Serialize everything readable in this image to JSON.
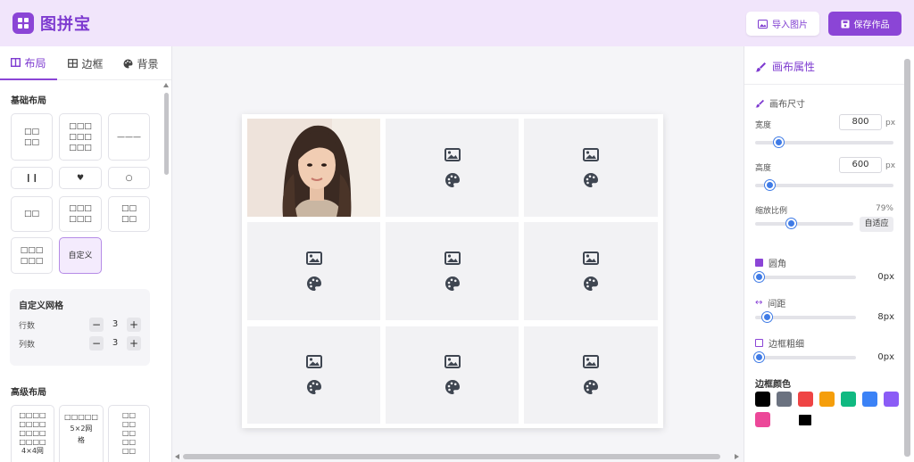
{
  "header": {
    "app_title": "图拼宝",
    "import_label": "导入图片",
    "save_label": "保存作品"
  },
  "left": {
    "tabs": [
      {
        "label": "布局",
        "icon": "columns-icon"
      },
      {
        "label": "边框",
        "icon": "grid-icon"
      },
      {
        "label": "背景",
        "icon": "palette-icon"
      }
    ],
    "basic_title": "基础布局",
    "basic_layouts": [
      "□□\n□□",
      "□□□\n□□□\n□□□",
      "———",
      "❙❙",
      "♥",
      "○",
      "□□",
      "□□□\n□□□",
      "□□\n□□",
      "□□□\n□□□",
      "自定义"
    ],
    "custom_grid": {
      "title": "自定义网格",
      "rows_label": "行数",
      "rows_value": "3",
      "cols_label": "列数",
      "cols_value": "3",
      "minus": "−",
      "plus": "+"
    },
    "advanced_title": "高级布局",
    "advanced_layouts": [
      "□□□□\n□□□□\n□□□□\n□□□□\n4×4网",
      "□□□□□\n5×2网\n格",
      "□□\n□□\n□□\n□□\n□□"
    ]
  },
  "canvas": {
    "cell_count": 9,
    "photo_cell": 0
  },
  "right": {
    "panel_title": "画布属性",
    "size_title": "画布尺寸",
    "width_label": "宽度",
    "width_value": "800",
    "height_label": "高度",
    "height_value": "600",
    "unit": "px",
    "zoom_label": "缩放比例",
    "zoom_value": "79%",
    "fit_label": "自适应",
    "radius_label": "圆角",
    "radius_value": "0px",
    "spacing_label": "间距",
    "spacing_value": "8px",
    "border_width_label": "边框粗细",
    "border_width_value": "0px",
    "border_color_label": "边框颜色",
    "sliders": {
      "width": 0.08,
      "height": 0.07,
      "zoom": 0.35,
      "radius": 0.0,
      "spacing": 0.08,
      "border_width": 0.0
    },
    "colors": [
      "#000000",
      "#6b7280",
      "#ef4444",
      "#f59e0b",
      "#10b981",
      "#3b82f6",
      "#8b5cf6",
      "#ec4899",
      "#000000"
    ]
  },
  "accent_color": "#8b45d6"
}
